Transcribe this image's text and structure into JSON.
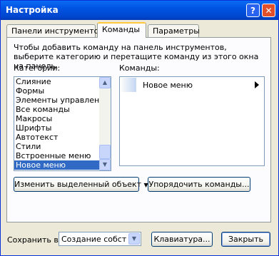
{
  "window": {
    "title": "Настройка",
    "help_glyph": "?",
    "close_glyph": "✕"
  },
  "tabs": [
    {
      "label": "Панели инструментов"
    },
    {
      "label": "Команды"
    },
    {
      "label": "Параметры"
    }
  ],
  "description": "Чтобы добавить команду на панель инструментов, выберите категорию и перетащите команду из этого окна на панель.",
  "categories_label": "Категории:",
  "categories": [
    "Слияние",
    "Формы",
    "Элементы управления",
    "Все команды",
    "Макросы",
    "Шрифты",
    "Автотекст",
    "Стили",
    "Встроенные меню",
    "Новое меню"
  ],
  "selected_category": "Новое меню",
  "commands_label": "Команды:",
  "commands": [
    {
      "label": "Новое меню"
    }
  ],
  "buttons": {
    "modify_selection": "Изменить выделенный объект",
    "rearrange_commands": "Упорядочить команды...",
    "keyboard": "Клавиатура...",
    "close": "Закрыть"
  },
  "save_in": {
    "label": "Сохранить в:",
    "value": "Создание собственн"
  },
  "icons": {
    "scroll_up": "▲",
    "scroll_down": "▼",
    "dropdown": "▼"
  }
}
